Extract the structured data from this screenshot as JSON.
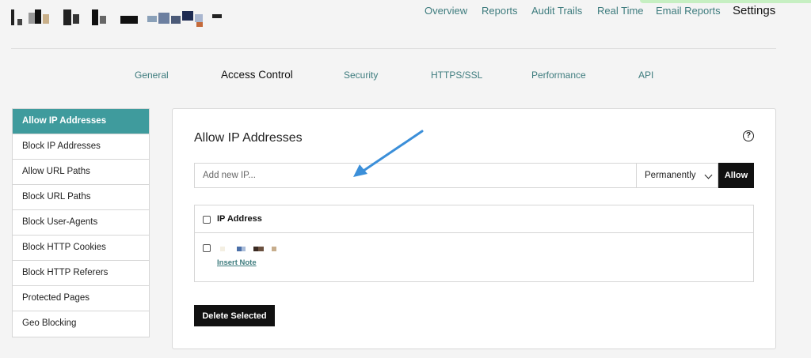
{
  "top_nav": {
    "items": [
      {
        "label": "Overview",
        "active": false
      },
      {
        "label": "Reports",
        "active": false
      },
      {
        "label": "Audit Trails",
        "active": false
      },
      {
        "label": "Real Time",
        "active": false
      },
      {
        "label": "Email Reports",
        "active": false
      },
      {
        "label": "Settings",
        "active": true
      }
    ]
  },
  "sub_tabs": {
    "items": [
      {
        "label": "General",
        "active": false
      },
      {
        "label": "Access Control",
        "active": true
      },
      {
        "label": "Security",
        "active": false
      },
      {
        "label": "HTTPS/SSL",
        "active": false
      },
      {
        "label": "Performance",
        "active": false
      },
      {
        "label": "API",
        "active": false
      }
    ]
  },
  "sidebar": {
    "items": [
      {
        "label": "Allow IP Addresses",
        "active": true
      },
      {
        "label": "Block IP Addresses",
        "active": false
      },
      {
        "label": "Allow URL Paths",
        "active": false
      },
      {
        "label": "Block URL Paths",
        "active": false
      },
      {
        "label": "Block User-Agents",
        "active": false
      },
      {
        "label": "Block HTTP Cookies",
        "active": false
      },
      {
        "label": "Block HTTP Referers",
        "active": false
      },
      {
        "label": "Protected Pages",
        "active": false
      },
      {
        "label": "Geo Blocking",
        "active": false
      }
    ]
  },
  "panel": {
    "title": "Allow IP Addresses",
    "help_icon": "question-circle-icon",
    "ip_input": {
      "placeholder": "Add new IP...",
      "value": ""
    },
    "duration_select": {
      "value": "Permanently"
    },
    "allow_label": "Allow",
    "table": {
      "header_label": "IP Address",
      "rows": [
        {
          "ip": "",
          "insert_note_label": "Insert Note"
        }
      ]
    },
    "delete_label": "Delete Selected"
  },
  "colors": {
    "accent": "#3f9b9d",
    "link": "#3e7c7e",
    "button": "#111111",
    "arrow": "#3b8fd9"
  }
}
